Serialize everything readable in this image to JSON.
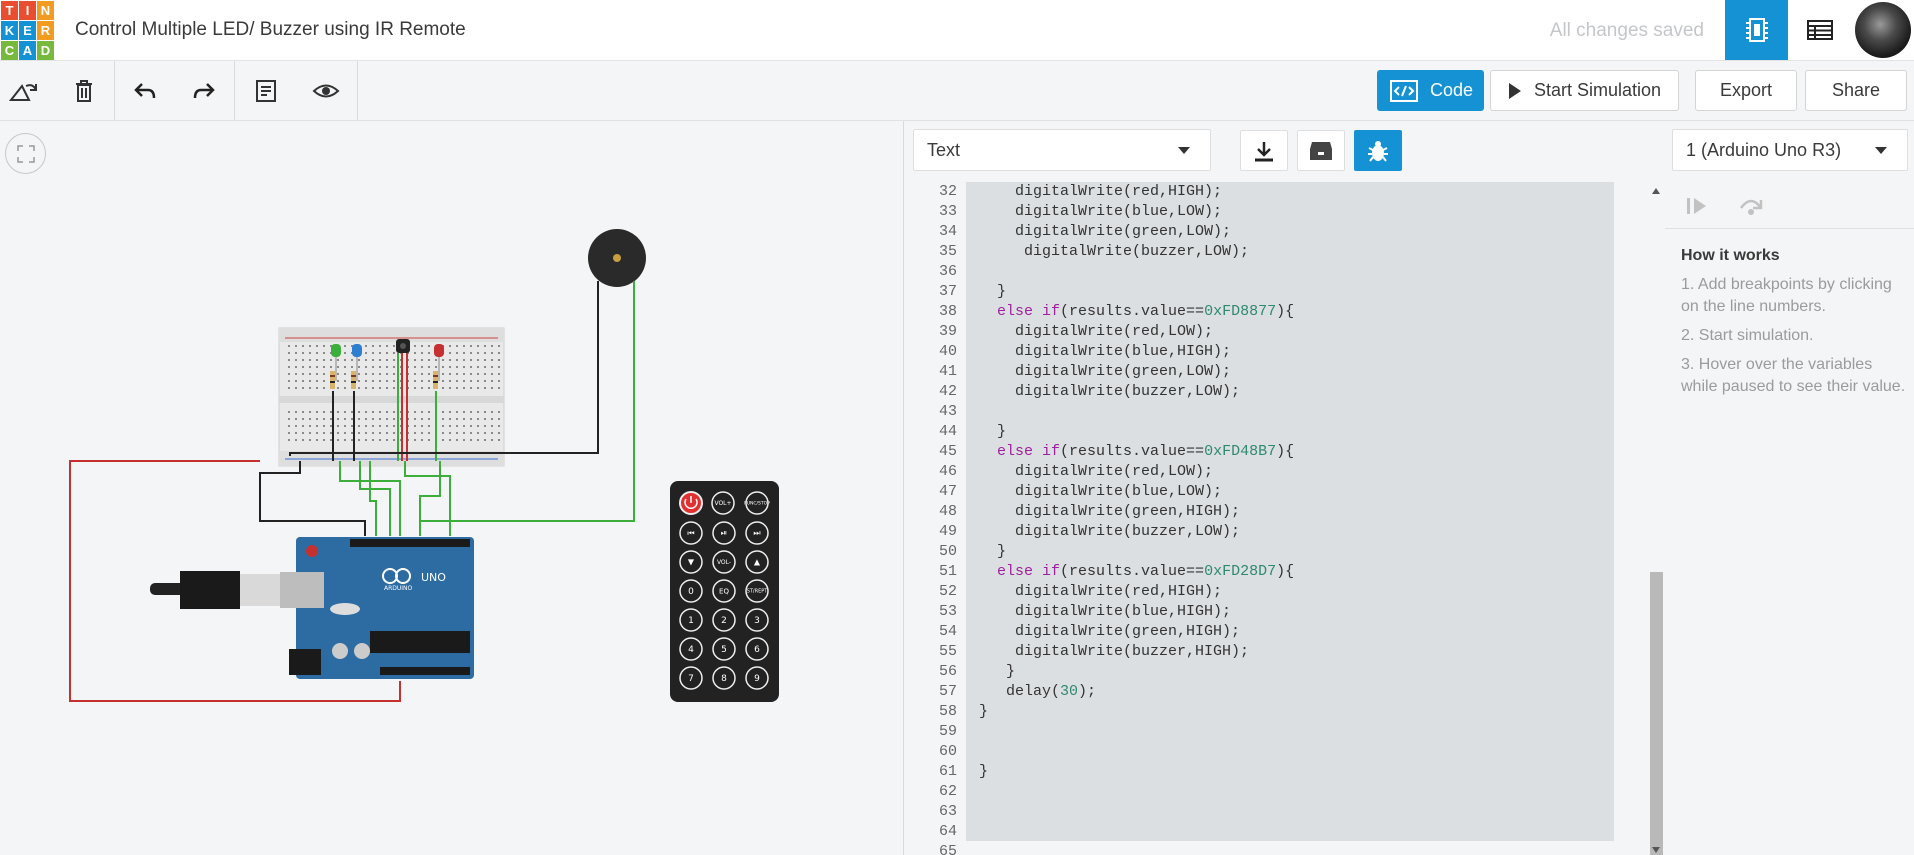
{
  "header": {
    "logo_letters": [
      "T",
      "I",
      "N",
      "K",
      "E",
      "R",
      "C",
      "A",
      "D"
    ],
    "logo_colors": [
      "#e94e31",
      "#e94e31",
      "#f29b21",
      "#1592d3",
      "#1592d3",
      "#f29b21",
      "#76b93d",
      "#1592d3",
      "#76b93d"
    ],
    "title": "Control Multiple LED/ Buzzer using IR Remote",
    "status": "All changes saved",
    "accent": "#1592d3"
  },
  "toolbar": {
    "code_label": "Code",
    "start_sim_label": "Start Simulation",
    "export_label": "Export",
    "share_label": "Share"
  },
  "code_panel": {
    "mode_select": "Text",
    "device_select": "1 (Arduino Uno R3)",
    "line_numbers": [
      "32",
      "33",
      "34",
      "35",
      "36",
      "37",
      "38",
      "39",
      "40",
      "41",
      "42",
      "43",
      "44",
      "45",
      "46",
      "47",
      "48",
      "49",
      "50",
      "51",
      "52",
      "53",
      "54",
      "55",
      "56",
      "57",
      "58",
      "59",
      "60",
      "61",
      "62",
      "63",
      "64",
      "65"
    ],
    "lines": [
      "     digitalWrite(red,HIGH);",
      "     digitalWrite(blue,LOW);",
      "     digitalWrite(green,LOW);",
      "      digitalWrite(buzzer,LOW);",
      "",
      "   }",
      "   else if(results.value==0xFD8877){",
      "     digitalWrite(red,LOW);",
      "     digitalWrite(blue,HIGH);",
      "     digitalWrite(green,LOW);",
      "     digitalWrite(buzzer,LOW);",
      "",
      "   }",
      "   else if(results.value==0xFD48B7){",
      "     digitalWrite(red,LOW);",
      "     digitalWrite(blue,LOW);",
      "     digitalWrite(green,HIGH);",
      "     digitalWrite(buzzer,LOW);",
      "   }",
      "   else if(results.value==0xFD28D7){",
      "     digitalWrite(red,HIGH);",
      "     digitalWrite(blue,HIGH);",
      "     digitalWrite(green,HIGH);",
      "     digitalWrite(buzzer,HIGH);",
      "    }",
      "    delay(30);",
      " }",
      "",
      "",
      " }",
      "",
      "",
      "",
      ""
    ]
  },
  "debugger": {
    "title": "How it works",
    "steps": [
      "1. Add breakpoints by clicking on the line numbers.",
      "2. Start simulation.",
      "3. Hover over the variables while paused to see their value."
    ]
  },
  "circuit": {
    "arduino_label": "UNO",
    "arduino_brand": "ARDUINO",
    "remote_keys": [
      "VOL+",
      "FUNC/STOP",
      "VOL-",
      "EQ",
      "ST/REPT",
      "0",
      "1",
      "2",
      "3",
      "4",
      "5",
      "6",
      "7",
      "8",
      "9"
    ]
  }
}
